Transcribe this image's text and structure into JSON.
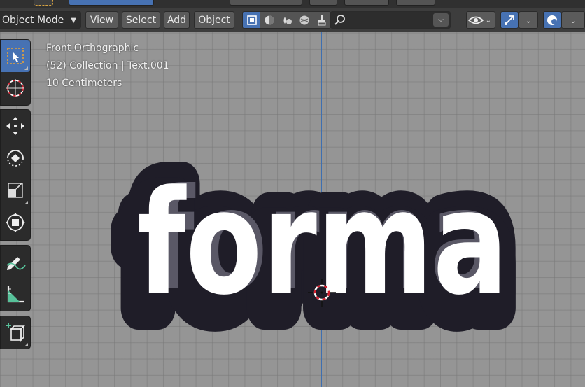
{
  "header": {
    "mode_label": "Object Mode",
    "menu": {
      "view": "View",
      "select": "Select",
      "add": "Add",
      "object": "Object"
    },
    "search_placeholder": ""
  },
  "viewport": {
    "view_name": "Front Orthographic",
    "collection_info": "(52) Collection | Text.001",
    "scale_info": "10 Centimeters",
    "text_object": "forma"
  },
  "colors": {
    "accent": "#4772b3",
    "axis_x": "#b04a55",
    "axis_z": "#3e6fb0",
    "text_fill": "#ffffff",
    "text_outline": "#1f1d28",
    "grid_bg": "#959595"
  },
  "toolbar": {
    "tools": [
      "select-box-icon",
      "cursor-icon",
      "move-icon",
      "rotate-icon",
      "scale-icon",
      "transform-icon",
      "annotate-icon",
      "measure-icon",
      "add-cube-icon"
    ]
  }
}
